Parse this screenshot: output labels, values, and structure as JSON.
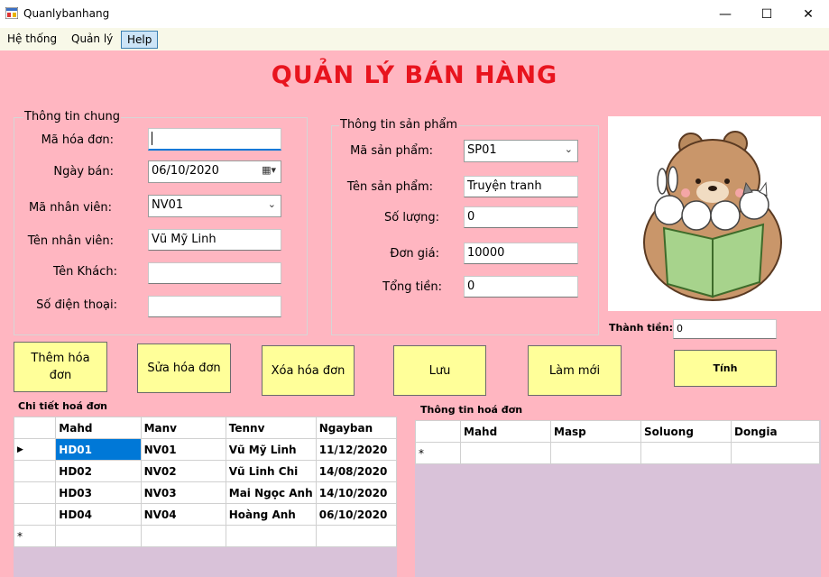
{
  "window": {
    "title": "Quanlybanhang",
    "minimize": "—",
    "maximize": "☐",
    "close": "✕"
  },
  "menu": {
    "items": [
      "Hệ thống",
      "Quản lý",
      "Help"
    ]
  },
  "main_title": "QUẢN LÝ BÁN HÀNG",
  "general_info": {
    "title": "Thông tin chung",
    "invoice_id_label": "Mã hóa đơn:",
    "invoice_id_value": "",
    "sale_date_label": "Ngày bán:",
    "sale_date_value": "06/10/2020",
    "staff_id_label": "Mã nhân viên:",
    "staff_id_value": "NV01",
    "staff_name_label": "Tên nhân viên:",
    "staff_name_value": "Vũ Mỹ Linh",
    "customer_label": "Tên Khách:",
    "customer_value": "",
    "phone_label": "Số điện thoại:",
    "phone_value": ""
  },
  "product_info": {
    "title": "Thông tin sản phẩm",
    "product_id_label": "Mã sản phẩm:",
    "product_id_value": "SP01",
    "product_name_label": "Tên sản phẩm:",
    "product_name_value": "Truyện tranh",
    "quantity_label": "Số lượng:",
    "quantity_value": "0",
    "unit_price_label": "Đơn giá:",
    "unit_price_value": "10000",
    "total_label": "Tổng tiền:",
    "total_value": "0"
  },
  "grand_total": {
    "label": "Thành tiền:",
    "value": "0"
  },
  "buttons": {
    "add_line1": "Thêm hóa",
    "add_line2": "đơn",
    "edit": "Sửa hóa đơn",
    "delete": "Xóa hóa đơn",
    "save": "Lưu",
    "refresh": "Làm mới",
    "calculate": "Tính"
  },
  "invoice_details": {
    "title": "Chi tiết hoá đơn",
    "columns": [
      "Mahd",
      "Manv",
      "Tennv",
      "Ngayban"
    ],
    "rows": [
      [
        "HD01",
        "NV01",
        "Vũ Mỹ Linh",
        "11/12/2020"
      ],
      [
        "HD02",
        "NV02",
        "Vũ Linh Chi",
        "14/08/2020"
      ],
      [
        "HD03",
        "NV03",
        "Mai Ngọc Anh",
        "14/10/2020"
      ],
      [
        "HD04",
        "NV04",
        "Hoàng Anh",
        "06/10/2020"
      ]
    ],
    "current_row_marker": "▶",
    "new_row_marker": "*"
  },
  "invoice_info": {
    "title": "Thông tin hoá đơn",
    "columns": [
      "Mahd",
      "Masp",
      "Soluong",
      "Dongia"
    ],
    "new_row_marker": "*"
  },
  "colors": {
    "background": "#ffb6c1",
    "title_red": "#e8141e",
    "button_yellow": "#ffff99",
    "grid_empty": "#d9c2d9",
    "selection": "#0078d7"
  }
}
